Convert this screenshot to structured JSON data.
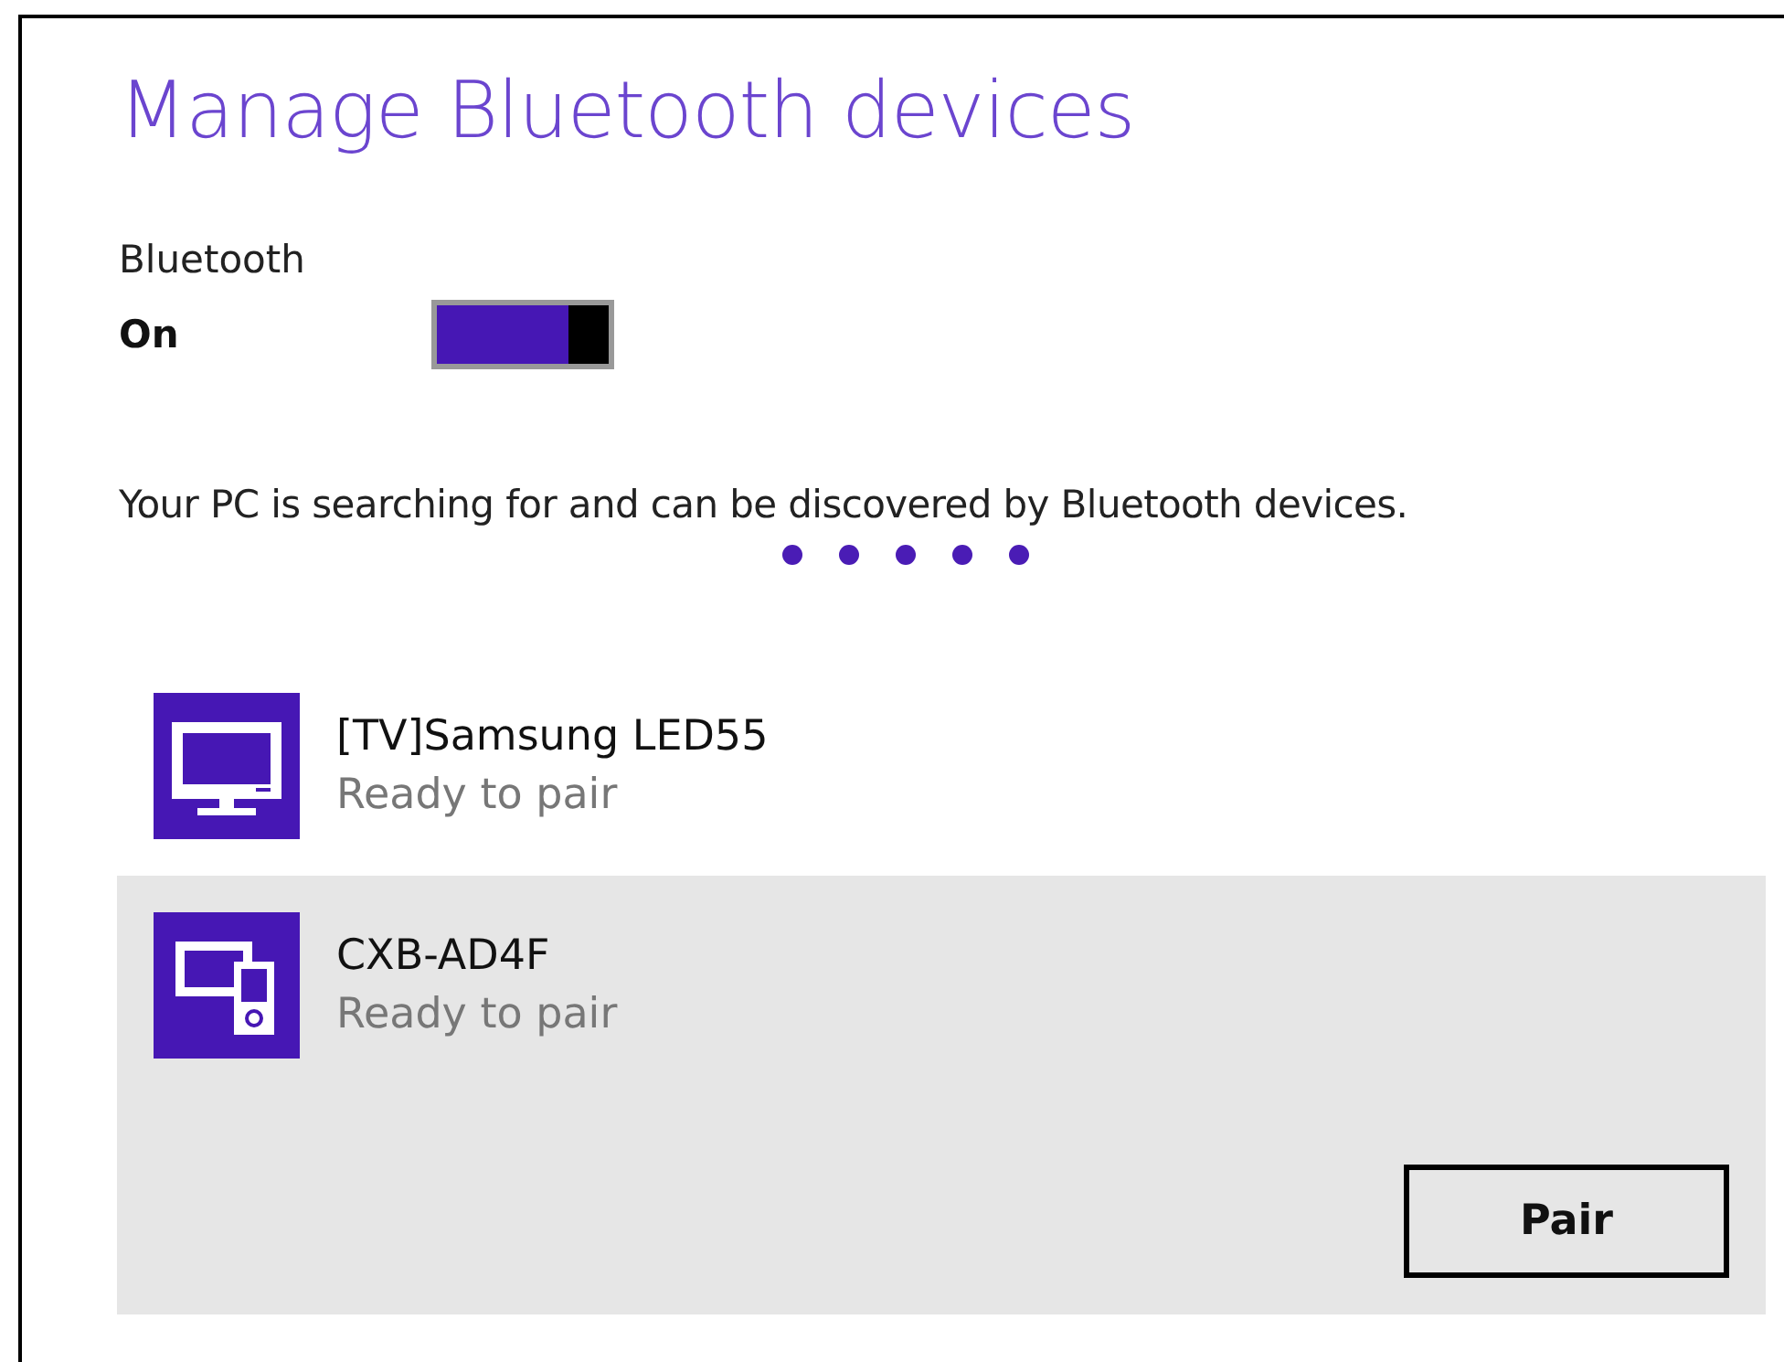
{
  "title": "Manage Bluetooth devices",
  "bluetooth": {
    "label": "Bluetooth",
    "state_text": "On",
    "on": true
  },
  "status": "Your PC is searching for and can be discovered by Bluetooth devices.",
  "devices": [
    {
      "kind": "tv",
      "name": "[TV]Samsung LED55",
      "status": "Ready to pair",
      "selected": false
    },
    {
      "kind": "multi",
      "name": "CXB-AD4F",
      "status": "Ready to pair",
      "selected": true
    }
  ],
  "pair_button": "Pair"
}
